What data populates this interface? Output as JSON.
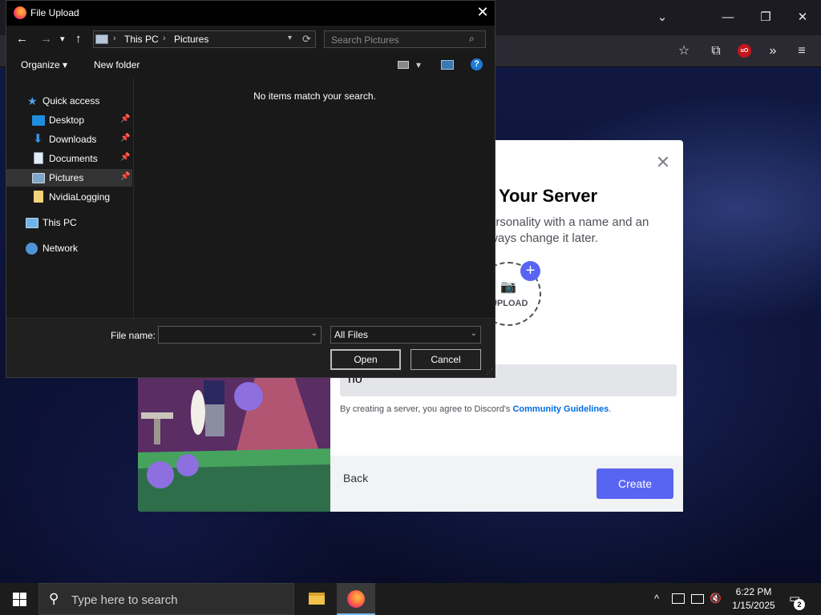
{
  "browser": {
    "window_controls": {
      "list_tabs": "⌄",
      "minimize": "—",
      "restore": "❐",
      "close": "✕"
    },
    "toolbar": {
      "bookmark": "☆",
      "extensions": "⧉",
      "ublock": "uO",
      "overflow": "»",
      "menu": "≡"
    }
  },
  "discord": {
    "title": "e Your Server",
    "subtitle": "ersonality with a name and an\nways change it later.",
    "upload_label": "UPLOAD",
    "server_name_value": "no",
    "terms_prefix": "By creating a server, you agree to Discord's ",
    "terms_link": "Community Guidelines",
    "terms_suffix": ".",
    "back_label": "Back",
    "create_label": "Create",
    "close_icon": "✕",
    "plus_icon": "+",
    "camera_icon": "📷",
    "brand_color": "#5865f2"
  },
  "dialog": {
    "title": "File Upload",
    "close": "✕",
    "nav": {
      "back": "←",
      "forward": "→",
      "recent": "▾",
      "up": "↑"
    },
    "breadcrumb": [
      "This PC",
      "Pictures"
    ],
    "breadcrumb_sep": "›",
    "address_dropdown": "▾",
    "refresh": "⟳",
    "search_placeholder": "Search Pictures",
    "search_icon": "⌕",
    "organize_label": "Organize ▾",
    "new_folder_label": "New folder",
    "view_dropdown": "▾",
    "help_label": "?",
    "empty_message": "No items match your search.",
    "sidebar": {
      "quick_access": "Quick access",
      "desktop": "Desktop",
      "downloads": "Downloads",
      "documents": "Documents",
      "pictures": "Pictures",
      "nvidia": "NvidiaLogging",
      "this_pc": "This PC",
      "network": "Network",
      "pin": "📌"
    },
    "file_name_label": "File name:",
    "file_name_value": "",
    "file_type_value": "All Files",
    "open_label": "Open",
    "cancel_label": "Cancel",
    "dropdown_arrow": "⌄"
  },
  "taskbar": {
    "search_placeholder": "Type here to search",
    "search_icon": "⚲",
    "time": "6:22 PM",
    "date": "1/15/2025",
    "notification_count": "2",
    "tray": {
      "chevron": "^",
      "volume": "🔇"
    }
  }
}
